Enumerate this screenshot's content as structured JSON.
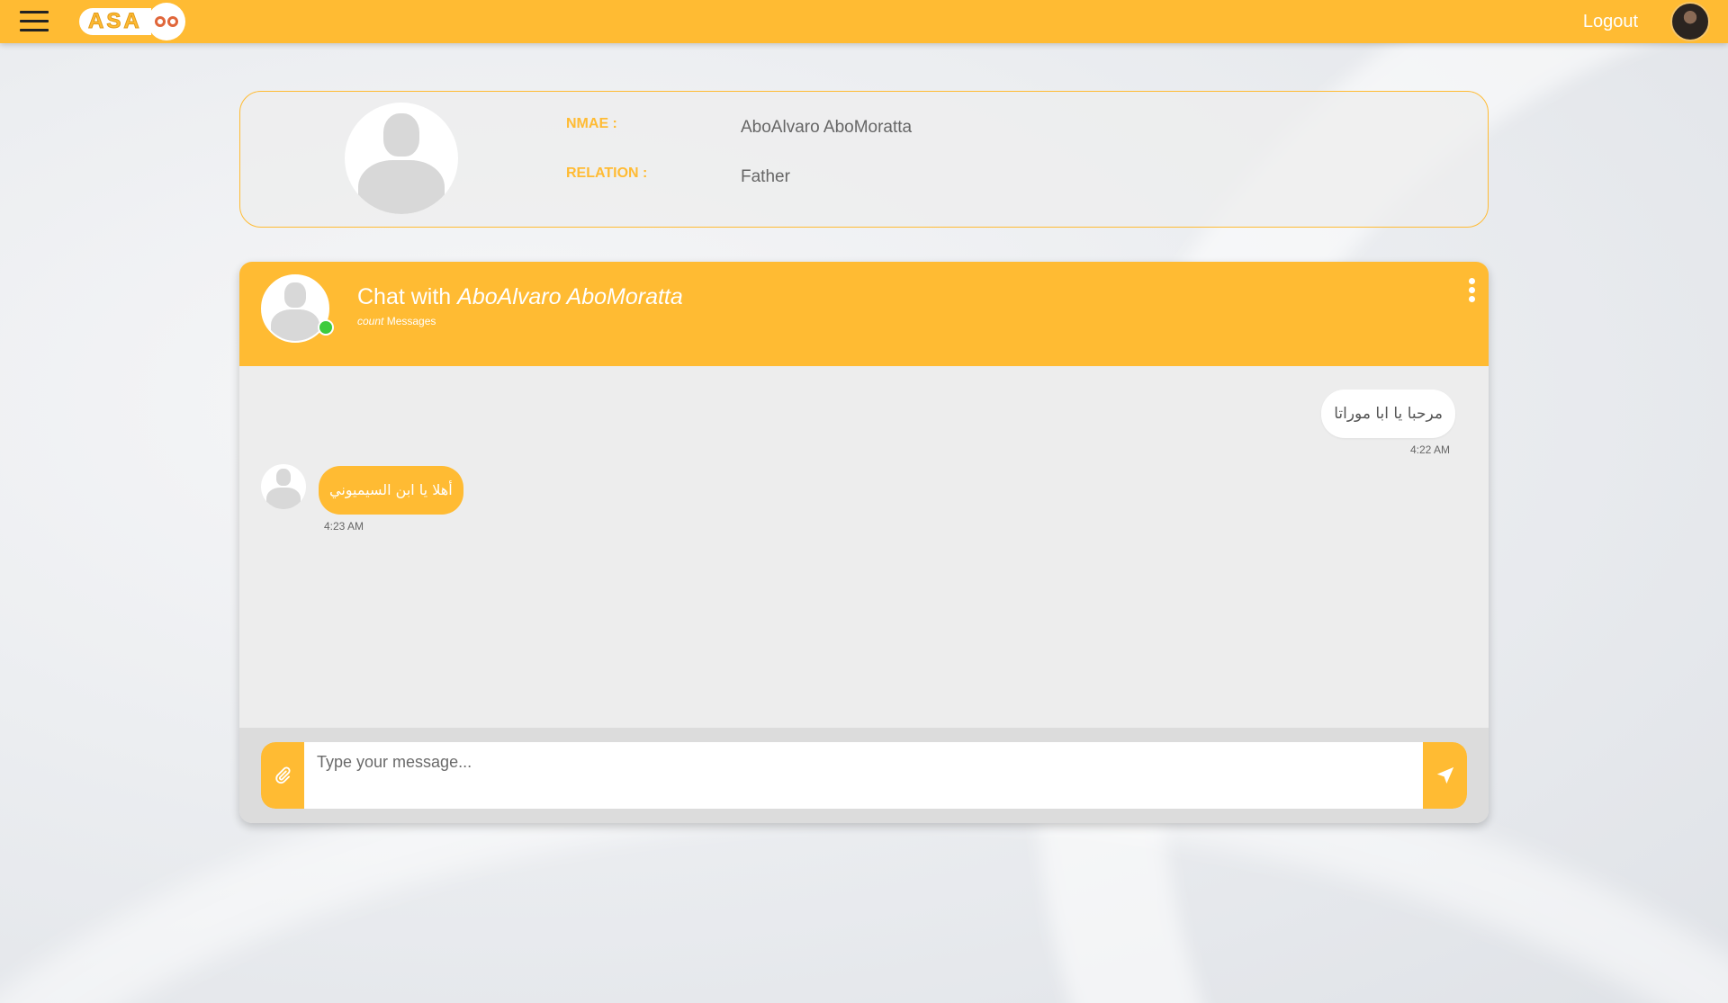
{
  "topbar": {
    "logo_text": "ASA",
    "logout_label": "Logout"
  },
  "profile": {
    "name_label": "NMAE :",
    "name_value": "AboAlvaro AboMoratta",
    "relation_label": "RELATION :",
    "relation_value": "Father"
  },
  "chat": {
    "title_prefix": "Chat with",
    "contact_name": "AboAlvaro AboMoratta",
    "count_label": "count",
    "messages_label": "Messages",
    "messages": [
      {
        "direction": "outgoing",
        "text": "مرحبا يا ابا موراتا",
        "time": "4:22 AM"
      },
      {
        "direction": "incoming",
        "text": "أهلا يا ابن السيميوني",
        "time": "4:23 AM"
      }
    ],
    "input_placeholder": "Type your message..."
  },
  "colors": {
    "accent": "#ffbb33",
    "online": "#3ecb3e"
  },
  "icons": [
    "menu-icon",
    "paperclip-icon",
    "send-icon",
    "more-vertical-icon"
  ]
}
